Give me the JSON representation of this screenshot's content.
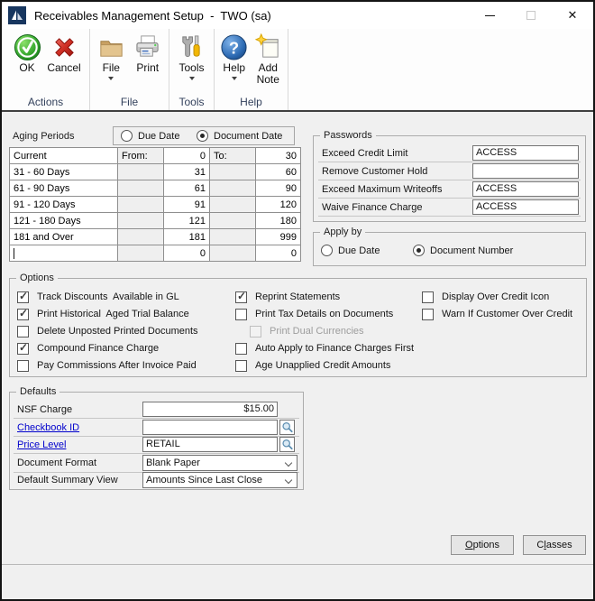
{
  "window": {
    "title": "Receivables Management Setup  -  TWO (sa)"
  },
  "icons": {
    "close": "✕",
    "check": "✓",
    "help_glyph": "?"
  },
  "colors": {
    "link_blue": "#0000cc",
    "ok_green": "#2fa32f",
    "cancel_red": "#c7261d",
    "help_blue": "#2d66ac",
    "folder_tan": "#d9b77f",
    "star_yellow": "#ffd23d"
  },
  "toolbar": {
    "groups": [
      {
        "label": "Actions",
        "buttons": [
          {
            "label": "OK"
          },
          {
            "label": "Cancel"
          }
        ]
      },
      {
        "label": "File",
        "buttons": [
          {
            "label": "File"
          },
          {
            "label": "Print"
          }
        ]
      },
      {
        "label": "Tools",
        "buttons": [
          {
            "label": "Tools"
          }
        ]
      },
      {
        "label": "Help",
        "buttons": [
          {
            "label": "Help"
          },
          {
            "label": "Add Note"
          }
        ]
      }
    ]
  },
  "aging": {
    "section_label": "Aging Periods",
    "date_mode_options": [
      {
        "label": "Due Date",
        "selected": false
      },
      {
        "label": "Document Date",
        "selected": true
      }
    ],
    "from_label": "From:",
    "to_label": "To:",
    "rows": [
      {
        "name": "Current",
        "from": "0",
        "to": "30"
      },
      {
        "name": "31 - 60 Days",
        "from": "31",
        "to": "60"
      },
      {
        "name": "61 - 90 Days",
        "from": "61",
        "to": "90"
      },
      {
        "name": "91 - 120 Days",
        "from": "91",
        "to": "120"
      },
      {
        "name": "121 - 180 Days",
        "from": "121",
        "to": "180"
      },
      {
        "name": "181 and Over",
        "from": "181",
        "to": "999"
      },
      {
        "name": "",
        "from": "0",
        "to": "0"
      }
    ]
  },
  "passwords": {
    "title": "Passwords",
    "rows": [
      {
        "label": "Exceed Credit Limit",
        "value": "ACCESS"
      },
      {
        "label": "Remove Customer Hold",
        "value": ""
      },
      {
        "label": "Exceed Maximum Writeoffs",
        "value": "ACCESS"
      },
      {
        "label": "Waive Finance Charge",
        "value": "ACCESS"
      }
    ]
  },
  "apply_by": {
    "title": "Apply by",
    "options": [
      {
        "label": "Due Date",
        "selected": false
      },
      {
        "label": "Document Number",
        "selected": true
      }
    ]
  },
  "options": {
    "title": "Options",
    "column1": [
      {
        "label": "Track Discounts  Available in GL",
        "checked": true,
        "disabled": false
      },
      {
        "label": "Print Historical  Aged Trial Balance",
        "checked": true,
        "disabled": false
      },
      {
        "label": "Delete Unposted Printed Documents",
        "checked": false,
        "disabled": false
      },
      {
        "label": "Compound Finance Charge",
        "checked": true,
        "disabled": false
      },
      {
        "label": "Pay Commissions After Invoice Paid",
        "checked": false,
        "disabled": false
      }
    ],
    "column2": [
      {
        "label": "Reprint Statements",
        "checked": true,
        "disabled": false
      },
      {
        "label": "Print Tax Details on Documents",
        "checked": false,
        "disabled": false
      },
      {
        "label": "Print Dual Currencies",
        "checked": false,
        "disabled": true
      },
      {
        "label": "Auto Apply to Finance Charges First",
        "checked": false,
        "disabled": false
      },
      {
        "label": "Age Unapplied Credit Amounts",
        "checked": false,
        "disabled": false
      }
    ],
    "column3": [
      {
        "label": "Display Over Credit Icon",
        "checked": false,
        "disabled": false
      },
      {
        "label": "Warn If Customer Over Credit",
        "checked": false,
        "disabled": false
      }
    ]
  },
  "defaults": {
    "title": "Defaults",
    "nsf_label": "NSF Charge",
    "nsf_value": "$15.00",
    "checkbook_label": "Checkbook ID",
    "checkbook_value": "",
    "price_label": "Price Level",
    "price_value": "RETAIL",
    "docformat_label": "Document Format",
    "docformat_value": "Blank Paper",
    "summary_label": "Default Summary View",
    "summary_value": "Amounts Since Last Close"
  },
  "footer": {
    "options_button": {
      "pre": "",
      "accel": "O",
      "rest": "ptions"
    },
    "classes_button": {
      "pre": "C",
      "accel": "l",
      "rest": "asses"
    }
  }
}
